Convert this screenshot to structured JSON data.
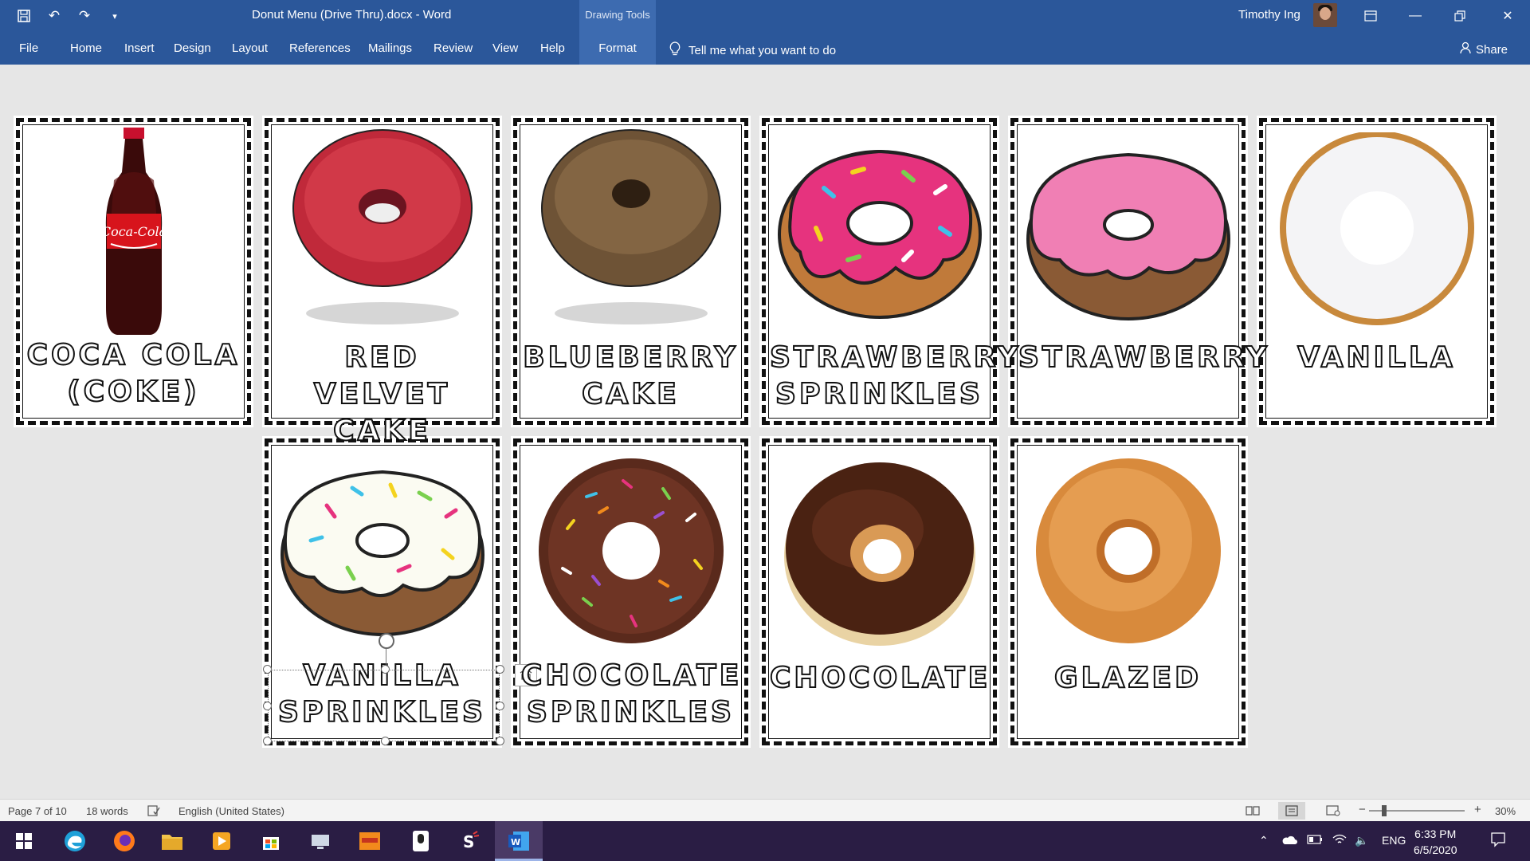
{
  "window": {
    "doc_title": "Donut Menu (Drive Thru).docx  -  Word",
    "context_group": "Drawing Tools",
    "user_name": "Timothy Ing"
  },
  "ribbon": {
    "tabs": [
      "File",
      "Home",
      "Insert",
      "Design",
      "Layout",
      "References",
      "Mailings",
      "Review",
      "View",
      "Help"
    ],
    "active_tab": "Format",
    "tell_me": "Tell me what you want to do",
    "share": "Share"
  },
  "cards": [
    {
      "label": "Coca Cola (Coke)",
      "icon": "coca-cola-bottle"
    },
    {
      "label": "Red Velvet Cake",
      "icon": "red-velvet-donut"
    },
    {
      "label": "Blueberry Cake",
      "icon": "blueberry-donut"
    },
    {
      "label": "Strawberry Sprinkles",
      "icon": "strawberry-sprinkles-donut"
    },
    {
      "label": "Strawberry",
      "icon": "strawberry-donut"
    },
    {
      "label": "Vanilla",
      "icon": "vanilla-donut"
    },
    {
      "label": "Vanilla Sprinkles",
      "icon": "vanilla-sprinkles-donut"
    },
    {
      "label": "Chocolate Sprinkles",
      "icon": "chocolate-sprinkles-donut"
    },
    {
      "label": "Chocolate",
      "icon": "chocolate-donut"
    },
    {
      "label": "Glazed",
      "icon": "glazed-donut"
    }
  ],
  "status": {
    "page": "Page 7 of 10",
    "words": "18 words",
    "language": "English (United States)",
    "zoom": "30%"
  },
  "taskbar": {
    "lang": "ENG",
    "time": "6:33 PM",
    "date": "6/5/2020"
  },
  "colors": {
    "word_blue": "#2b579a",
    "taskbar": "#2a1d44"
  }
}
